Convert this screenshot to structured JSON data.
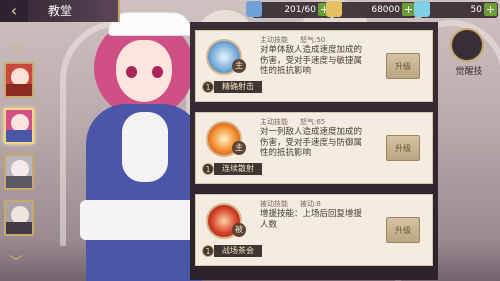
{
  "header": {
    "back_icon": "back-arrow-icon",
    "title": "教堂"
  },
  "resources": {
    "stamina": {
      "icon": "stamina-icon",
      "value": "201/60",
      "color": "#6fa0d8"
    },
    "coins": {
      "icon": "coin-icon",
      "value": "68000",
      "color": "#e6c160"
    },
    "gems": {
      "icon": "gem-icon",
      "value": "50",
      "color": "#7fd0e6"
    },
    "add_icon": "plus-icon"
  },
  "side_nav": {
    "up_icon": "chevron-up-icon",
    "down_icon": "chevron-down-icon"
  },
  "skills": [
    {
      "icon": "crossed-blades-skill-icon",
      "tag": "主",
      "level": "1",
      "name": "精确射击",
      "type": "主动技能",
      "cooldown": "怒气:50",
      "description": "对单体敌人造成速度加成的伤害，受对手速度与敏捷属性的抵抗影响",
      "upgrade_label": "升级"
    },
    {
      "icon": "fire-strike-skill-icon",
      "tag": "主",
      "level": "1",
      "name": "连续散射",
      "type": "主动技能",
      "cooldown": "怒气:65",
      "description": "对一列敌人造成速度加成的伤害，受对手速度与防御属性的抵抗影响",
      "upgrade_label": "升级"
    },
    {
      "icon": "flame-aura-skill-icon",
      "tag": "被",
      "level": "1",
      "name": "战场茶会",
      "type": "被动技能",
      "cooldown": "被动:8",
      "description": "增援技能：上场后回复增援人数",
      "upgrade_label": "升级"
    }
  ],
  "awaken": {
    "icon": "awaken-portrait-icon",
    "label": "觉醒技"
  },
  "colors": {
    "panel_bg": "#2c222a",
    "card_bg": "#f4ebe1",
    "accent_gold": "#c9a86a"
  }
}
